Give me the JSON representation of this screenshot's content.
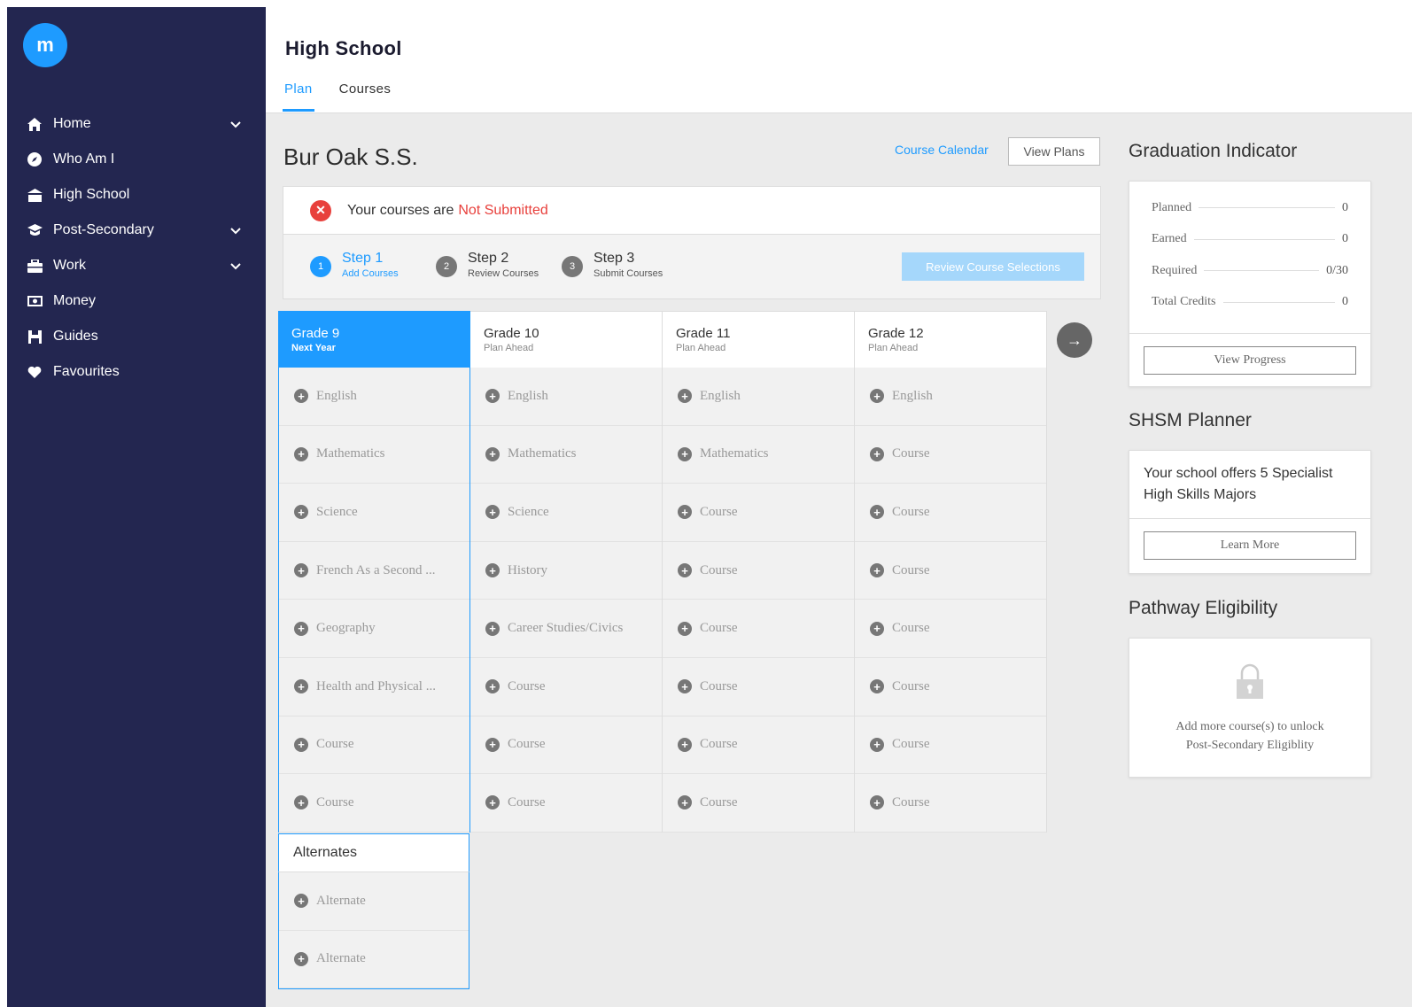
{
  "sidebar": {
    "logo_text": "m",
    "items": [
      {
        "label": "Home",
        "icon": "home-icon",
        "chevron": true
      },
      {
        "label": "Who Am I",
        "icon": "compass-icon",
        "chevron": false
      },
      {
        "label": "High School",
        "icon": "school-icon",
        "chevron": false
      },
      {
        "label": "Post-Secondary",
        "icon": "graduation-cap-icon",
        "chevron": true
      },
      {
        "label": "Work",
        "icon": "briefcase-icon",
        "chevron": true
      },
      {
        "label": "Money",
        "icon": "money-icon",
        "chevron": false
      },
      {
        "label": "Guides",
        "icon": "guide-book-icon",
        "chevron": false
      },
      {
        "label": "Favourites",
        "icon": "heart-icon",
        "chevron": false
      }
    ]
  },
  "header": {
    "title": "High School",
    "tabs": [
      {
        "label": "Plan"
      },
      {
        "label": "Courses"
      }
    ]
  },
  "main": {
    "school_name": "Bur Oak S.S.",
    "course_calendar_link": "Course Calendar",
    "view_plans_label": "View Plans",
    "status": {
      "prefix": "Your courses are",
      "value": "Not Submitted"
    },
    "steps": [
      {
        "num": "1",
        "title": "Step 1",
        "sub": "Add Courses"
      },
      {
        "num": "2",
        "title": "Step 2",
        "sub": "Review Courses"
      },
      {
        "num": "3",
        "title": "Step 3",
        "sub": "Submit Courses"
      }
    ],
    "review_button": "Review Course Selections",
    "grades": [
      {
        "title": "Grade 9",
        "sub": "Next Year",
        "courses": [
          "English",
          "Mathematics",
          "Science",
          "French As a Second ...",
          "Geography",
          "Health and Physical ...",
          "Course",
          "Course"
        ]
      },
      {
        "title": "Grade 10",
        "sub": "Plan Ahead",
        "courses": [
          "English",
          "Mathematics",
          "Science",
          "History",
          "Career Studies/Civics",
          "Course",
          "Course",
          "Course"
        ]
      },
      {
        "title": "Grade 11",
        "sub": "Plan Ahead",
        "courses": [
          "English",
          "Mathematics",
          "Course",
          "Course",
          "Course",
          "Course",
          "Course",
          "Course"
        ]
      },
      {
        "title": "Grade 12",
        "sub": "Plan Ahead",
        "courses": [
          "English",
          "Course",
          "Course",
          "Course",
          "Course",
          "Course",
          "Course",
          "Course"
        ]
      }
    ],
    "alternates": {
      "title": "Alternates",
      "items": [
        "Alternate",
        "Alternate"
      ]
    }
  },
  "right": {
    "graduation": {
      "title": "Graduation Indicator",
      "rows": [
        {
          "label": "Planned",
          "value": "0"
        },
        {
          "label": "Earned",
          "value": "0"
        },
        {
          "label": "Required",
          "value": "0/30"
        },
        {
          "label": "Total Credits",
          "value": "0"
        }
      ],
      "button": "View Progress"
    },
    "shsm": {
      "title": "SHSM Planner",
      "text": "Your school offers 5 Specialist High Skills Majors",
      "button": "Learn More"
    },
    "pathway": {
      "title": "Pathway Eligibility",
      "line1": "Add more course(s) to unlock",
      "line2": "Post-Secondary Eligiblity"
    }
  },
  "colors": {
    "sidebar_bg": "#232650",
    "accent": "#1e9bff",
    "error": "#e8403c"
  }
}
